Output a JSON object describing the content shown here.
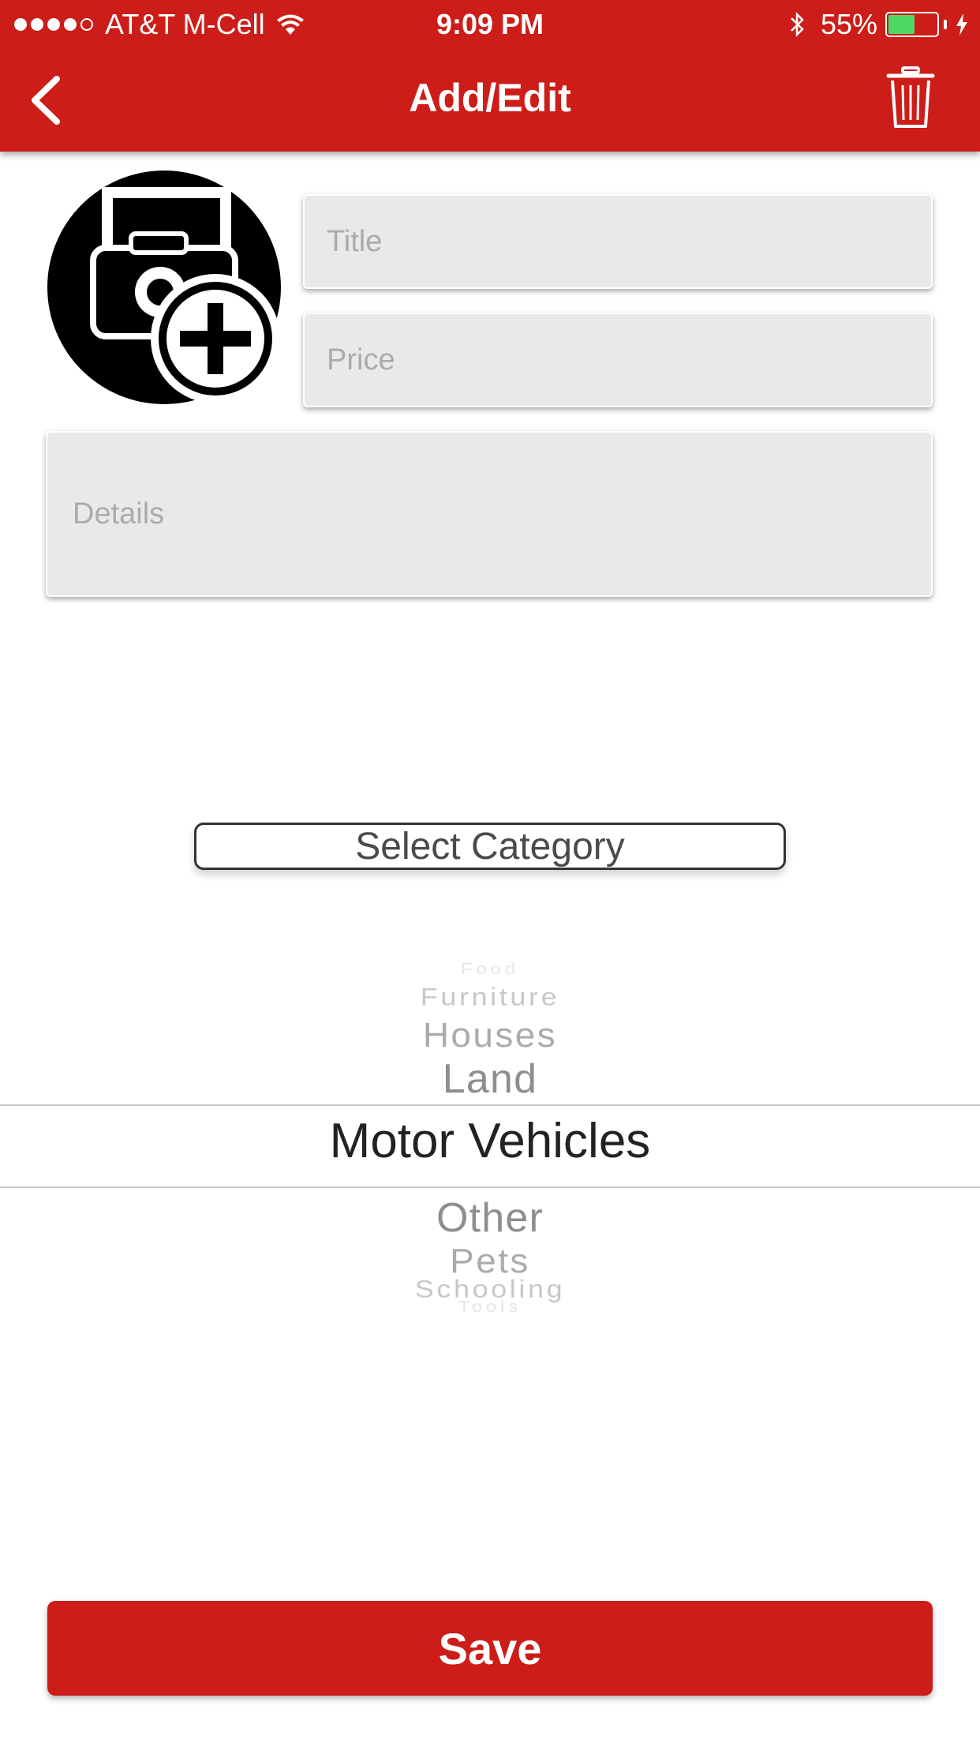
{
  "status_bar": {
    "carrier": "AT&T M-Cell",
    "time": "9:09 PM",
    "battery_percent": "55%",
    "battery_level": 0.55,
    "signal_bars_filled": 4,
    "signal_bars_total": 5
  },
  "header": {
    "title": "Add/Edit",
    "back_icon": "chevron-left-icon",
    "delete_icon": "trash-icon",
    "color": "#cc1d18"
  },
  "photo": {
    "icon": "add-photo-icon"
  },
  "form": {
    "title_placeholder": "Title",
    "title_value": "",
    "price_placeholder": "Price",
    "price_value": "",
    "details_placeholder": "Details",
    "details_value": ""
  },
  "category": {
    "button_label": "Select Category",
    "options": [
      "Food",
      "Furniture",
      "Houses",
      "Land",
      "Motor Vehicles",
      "Other",
      "Pets",
      "Schooling",
      "Tools"
    ],
    "selected": "Motor Vehicles"
  },
  "save_button": {
    "label": "Save"
  }
}
